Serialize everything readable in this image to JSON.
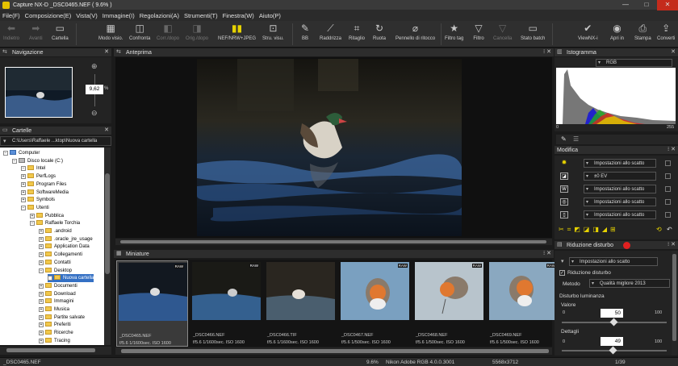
{
  "window": {
    "title": "Capture NX-D   _DSC0465.NEF ( 9.6% )",
    "min": "—",
    "max": "□",
    "close": "✕"
  },
  "menu": [
    "File(F)",
    "Composizione(E)",
    "Vista(V)",
    "Immagine(I)",
    "Regolazioni(A)",
    "Strumenti(T)",
    "Finestra(W)",
    "Aiuto(P)"
  ],
  "toolbar": {
    "back": "Indietro",
    "forward": "Avanti",
    "folder": "Cartella",
    "view_mode": "Modo visio.",
    "compare": "Confronta",
    "before_after": "Corr./dopo",
    "orig_after": "Orig./dopo",
    "nef_jpeg": "NEF/NRW+JPEG",
    "display_tools": "Stru. visu.",
    "wb": "BB",
    "straighten": "Raddrizza",
    "crop": "Ritaglio",
    "rotate": "Ruota",
    "retouch": "Pennello di ritocco",
    "tag_filter": "Filtro tag",
    "filter": "Filtro",
    "delete": "Cancella",
    "batch": "Stato batch",
    "viewnx": "ViewNX-i",
    "open_in": "Apri in",
    "print": "Stampa",
    "convert": "Converti"
  },
  "nav": {
    "title": "Navigazione",
    "zoom": "9,62",
    "unit": "%"
  },
  "folders": {
    "title": "Cartelle",
    "path": "C:\\Users\\Raffaele ...ktop\\Nuova cartella",
    "tree": [
      {
        "label": "Computer",
        "lvl": 0
      },
      {
        "label": "Disco locale (C:)",
        "lvl": 1
      },
      {
        "label": "Intel",
        "lvl": 2
      },
      {
        "label": "PerfLogs",
        "lvl": 2
      },
      {
        "label": "Program Files",
        "lvl": 2
      },
      {
        "label": "SoftwareMedia",
        "lvl": 2
      },
      {
        "label": "Symbols",
        "lvl": 2
      },
      {
        "label": "Utenti",
        "lvl": 2
      },
      {
        "label": "Pubblica",
        "lvl": 3
      },
      {
        "label": "Raffaele Torchia",
        "lvl": 3
      },
      {
        "label": ".android",
        "lvl": 4
      },
      {
        "label": ".oracle_jre_usage",
        "lvl": 4
      },
      {
        "label": "Application Data",
        "lvl": 4
      },
      {
        "label": "Collegamenti",
        "lvl": 4
      },
      {
        "label": "Contatti",
        "lvl": 4
      },
      {
        "label": "Desktop",
        "lvl": 4
      },
      {
        "label": "Nuova cartella",
        "lvl": 5,
        "sel": true
      },
      {
        "label": "Documenti",
        "lvl": 4
      },
      {
        "label": "Download",
        "lvl": 4
      },
      {
        "label": "Immagini",
        "lvl": 4
      },
      {
        "label": "Musica",
        "lvl": 4
      },
      {
        "label": "Partite salvate",
        "lvl": 4
      },
      {
        "label": "Preferiti",
        "lvl": 4
      },
      {
        "label": "Ricerche",
        "lvl": 4
      },
      {
        "label": "Tracing",
        "lvl": 4
      }
    ]
  },
  "preview": {
    "title": "Anteprima"
  },
  "thumbs": {
    "title": "Miniature",
    "raw": "RAW",
    "items": [
      {
        "name": "_DSC0465.NEF",
        "exif": "f/5.6 1/1600sec. ISO 1600",
        "sel": true,
        "raw": true
      },
      {
        "name": "_DSC0466.NEF",
        "exif": "f/5.6 1/1600sec. ISO 1600",
        "raw": true
      },
      {
        "name": "_DSC0466.TIF",
        "exif": "f/5.6 1/1600sec. ISO 1600",
        "raw": false
      },
      {
        "name": "_DSC0467.NEF",
        "exif": "f/5.6 1/500sec. ISO 1600",
        "raw": true
      },
      {
        "name": "_DSC0468.NEF",
        "exif": "f/5.6 1/500sec. ISO 1600",
        "raw": true
      },
      {
        "name": "_DSC0469.NEF",
        "exif": "f/5.6 1/500sec. ISO 1600",
        "raw": true
      }
    ]
  },
  "hist": {
    "title": "Istogramma",
    "channel": "RGB",
    "min": "0",
    "max": "255"
  },
  "modify": {
    "title": "Modifica",
    "rows": [
      "Impostazioni allo scatto",
      "±0 EV",
      "Impostazioni allo scatto",
      "Impostazioni allo scatto",
      "Impostazioni allo scatto"
    ]
  },
  "nr": {
    "title": "Riduzione disturbo",
    "preset": "Impostazioni allo scatto",
    "enable": "Riduzione disturbo",
    "method_label": "Metodo",
    "method": "Qualità migliore 2013",
    "lum_title": "Disturbo luminanza",
    "value_label": "Valore",
    "value": "50",
    "detail_label": "Dettagli",
    "detail": "49",
    "min": "0",
    "max": "100"
  },
  "status": {
    "file": "_DSC0465.NEF",
    "zoom": "9.6%",
    "profile": "Nikon Adobe RGB 4.0.0.3001",
    "size": "5568x3712",
    "page": "1/39"
  }
}
